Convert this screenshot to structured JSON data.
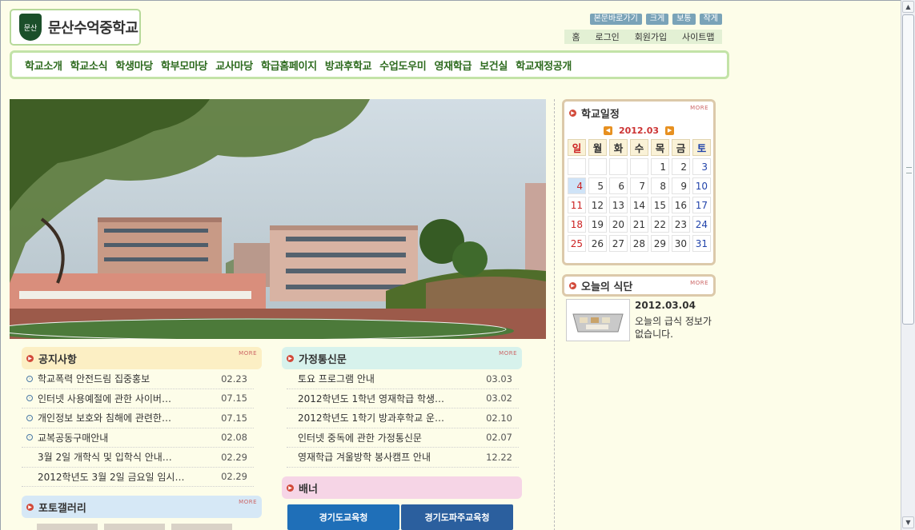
{
  "header": {
    "school_name": "문산수억중학교",
    "emblem_text": "문산",
    "size_buttons": [
      "본문바로가기",
      "크게",
      "보통",
      "작게"
    ],
    "util_links": [
      "홈",
      "로그인",
      "회원가입",
      "사이트맵"
    ]
  },
  "gnb": [
    "학교소개",
    "학교소식",
    "학생마당",
    "학부모마당",
    "교사마당",
    "학급홈페이지",
    "방과후학교",
    "수업도우미",
    "영재학급",
    "보건실",
    "학교재정공개"
  ],
  "notice": {
    "title": "공지사항",
    "more": "MORE",
    "items": [
      {
        "text": "학교폭력 안전드림 집중홍보",
        "date": "02.23",
        "bullet": true
      },
      {
        "text": "인터넷 사용예절에 관한 사이버…",
        "date": "07.15",
        "bullet": true
      },
      {
        "text": "개인정보 보호와 침해에 관련한…",
        "date": "07.15",
        "bullet": true
      },
      {
        "text": "교복공동구매안내",
        "date": "02.08",
        "bullet": true
      },
      {
        "text": "3월 2일 개학식 및 입학식 안내…",
        "date": "02.29",
        "bullet": false
      },
      {
        "text": "2012학년도 3월 2일 금요일 임시…",
        "date": "02.29",
        "bullet": false
      }
    ]
  },
  "letters": {
    "title": "가정통신문",
    "more": "MORE",
    "items": [
      {
        "text": "토요 프로그램 안내",
        "date": "03.03"
      },
      {
        "text": "2012학년도 1학년 영재학급 학생…",
        "date": "03.02"
      },
      {
        "text": "2012학년도 1학기 방과후학교 운…",
        "date": "02.10"
      },
      {
        "text": "인터넷 중독에 관한 가정통신문",
        "date": "02.07"
      },
      {
        "text": "영재학급 겨울방학 봉사캠프 안내",
        "date": "12.22"
      }
    ]
  },
  "gallery": {
    "title": "포토갤러리",
    "more": "MORE"
  },
  "banner": {
    "title": "배너",
    "items": [
      "경기도교육청",
      "경기도파주교육청"
    ]
  },
  "calendar": {
    "title": "학교일정",
    "more": "MORE",
    "month": "2012.03",
    "weekdays": [
      "일",
      "월",
      "화",
      "수",
      "목",
      "금",
      "토"
    ],
    "weeks": [
      [
        "",
        "",
        "",
        "",
        "1",
        "2",
        "3"
      ],
      [
        "4",
        "5",
        "6",
        "7",
        "8",
        "9",
        "10"
      ],
      [
        "11",
        "12",
        "13",
        "14",
        "15",
        "16",
        "17"
      ],
      [
        "18",
        "19",
        "20",
        "21",
        "22",
        "23",
        "24"
      ],
      [
        "25",
        "26",
        "27",
        "28",
        "29",
        "30",
        "31"
      ]
    ],
    "today": "4"
  },
  "meal": {
    "title": "오늘의 식단",
    "more": "MORE",
    "date": "2012.03.04",
    "message": "오늘의 급식 정보가 없습니다."
  }
}
